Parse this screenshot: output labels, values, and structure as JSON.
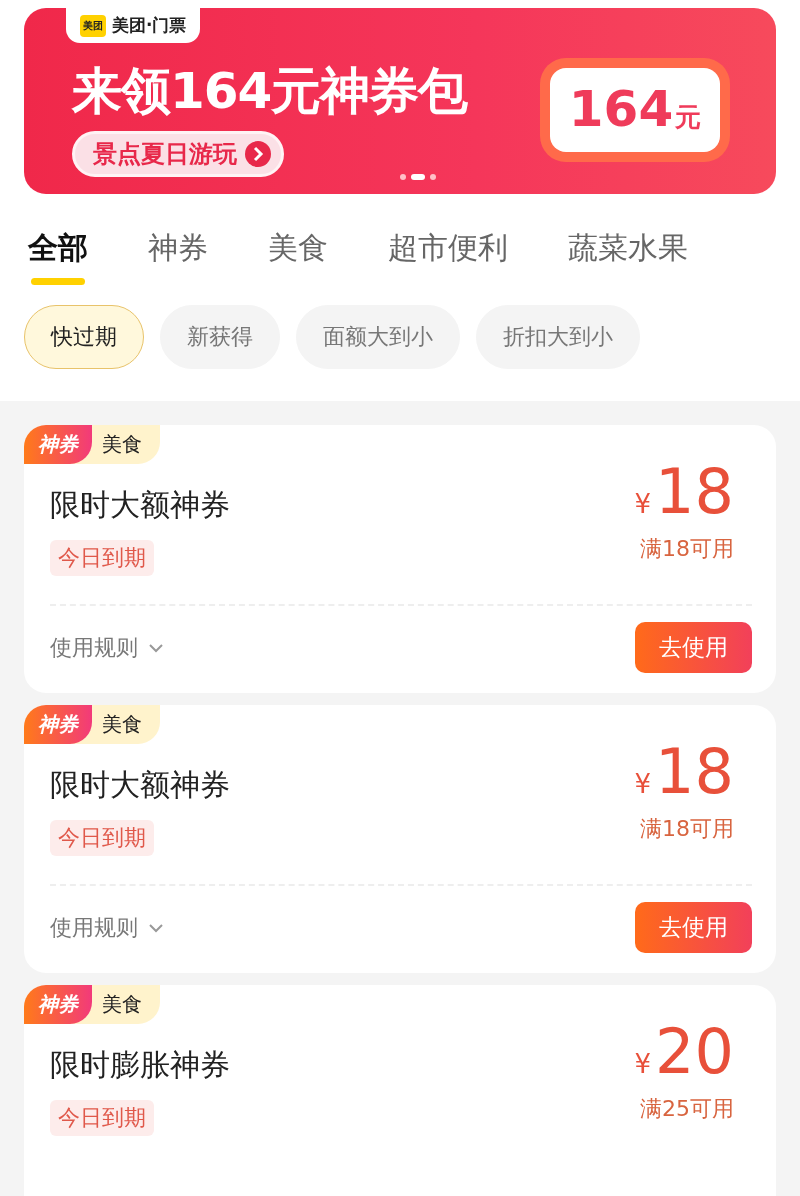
{
  "banner": {
    "logo": "美团",
    "brand": "美团·门票",
    "headline": "来领164元神券包",
    "cta": "景点夏日游玩",
    "amount": "164",
    "unit": "元",
    "dots": [
      {
        "selected": false
      },
      {
        "selected": true
      },
      {
        "selected": false
      }
    ]
  },
  "tabs": [
    {
      "label": "全部",
      "selected": true
    },
    {
      "label": "神券",
      "selected": false
    },
    {
      "label": "美食",
      "selected": false
    },
    {
      "label": "超市便利",
      "selected": false
    },
    {
      "label": "蔬菜水果",
      "selected": false
    }
  ],
  "filters": [
    {
      "label": "快过期",
      "selected": true
    },
    {
      "label": "新获得",
      "selected": false
    },
    {
      "label": "面额大到小",
      "selected": false
    },
    {
      "label": "折扣大到小",
      "selected": false
    }
  ],
  "coupons": [
    {
      "badge": "神券",
      "category": "美食",
      "title": "限时大额神券",
      "expiry": "今日到期",
      "currency": "¥",
      "value": "18",
      "condition": "满18可用",
      "rule": "使用规则",
      "action": "去使用"
    },
    {
      "badge": "神券",
      "category": "美食",
      "title": "限时大额神券",
      "expiry": "今日到期",
      "currency": "¥",
      "value": "18",
      "condition": "满18可用",
      "rule": "使用规则",
      "action": "去使用"
    },
    {
      "badge": "神券",
      "category": "美食",
      "title": "限时膨胀神券",
      "expiry": "今日到期",
      "currency": "¥",
      "value": "20",
      "condition": "满25可用"
    }
  ]
}
